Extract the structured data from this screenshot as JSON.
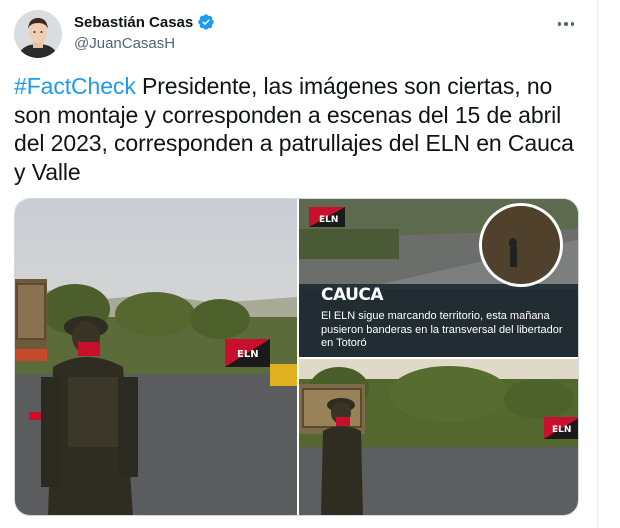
{
  "author": {
    "display_name": "Sebastián Casas",
    "handle": "@JuanCasasH",
    "verified": true
  },
  "tweet": {
    "hashtag": "#FactCheck",
    "text": " Presidente, las imágenes son ciertas, no son montaje y corresponden a escenas del 15 de abril del 2023, corresponden a patrullajes del ELN en Cauca y Valle"
  },
  "media": {
    "image1": {
      "flag_text": "ELN"
    },
    "image2": {
      "flag_text": "ELN",
      "overlay_title": "CAUCA",
      "overlay_body": "El ELN sigue marcando territorio, esta mañana pusieron banderas en la transversal del libertador en Totoró"
    },
    "image3": {
      "flag_text": "ELN"
    }
  },
  "colors": {
    "hashtag": "#1d9bf0",
    "verified": "#1d9bf0",
    "flag_red": "#c8102e",
    "flag_black": "#1a1a1a"
  },
  "icons": [
    "verified-badge-icon",
    "more-options-icon"
  ]
}
